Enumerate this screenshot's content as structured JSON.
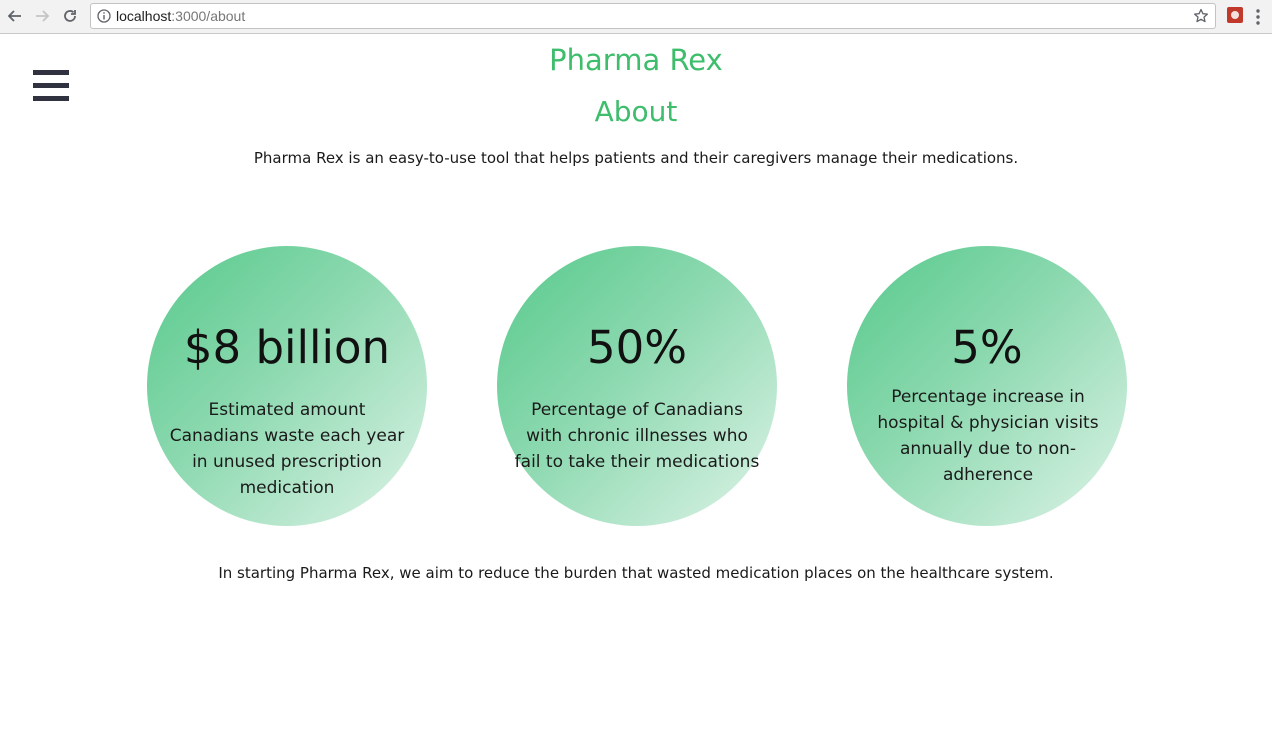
{
  "browser": {
    "url_host": "localhost",
    "url_path": ":3000/about"
  },
  "header": {
    "site_title": "Pharma Rex",
    "page_heading": "About"
  },
  "main": {
    "intro": "Pharma Rex is an easy-to-use tool that helps patients and their caregivers manage their medications.",
    "stats": [
      {
        "value": "$8 billion",
        "description": "Estimated amount Canadians waste each year in unused prescription medication"
      },
      {
        "value": "50%",
        "description": "Percentage of Canadians with chronic illnesses who fail to take their medications"
      },
      {
        "value": "5%",
        "description": "Percentage increase in hospital & physician visits annually due to non-adherence"
      }
    ],
    "closing": "In starting Pharma Rex, we aim to reduce the burden that wasted medication places on the healthcare system."
  },
  "colors": {
    "accent": "#3ebd6c",
    "circle_gradient_start": "#56c98b",
    "circle_gradient_end": "#def3e8",
    "hamburger": "#30323f"
  }
}
